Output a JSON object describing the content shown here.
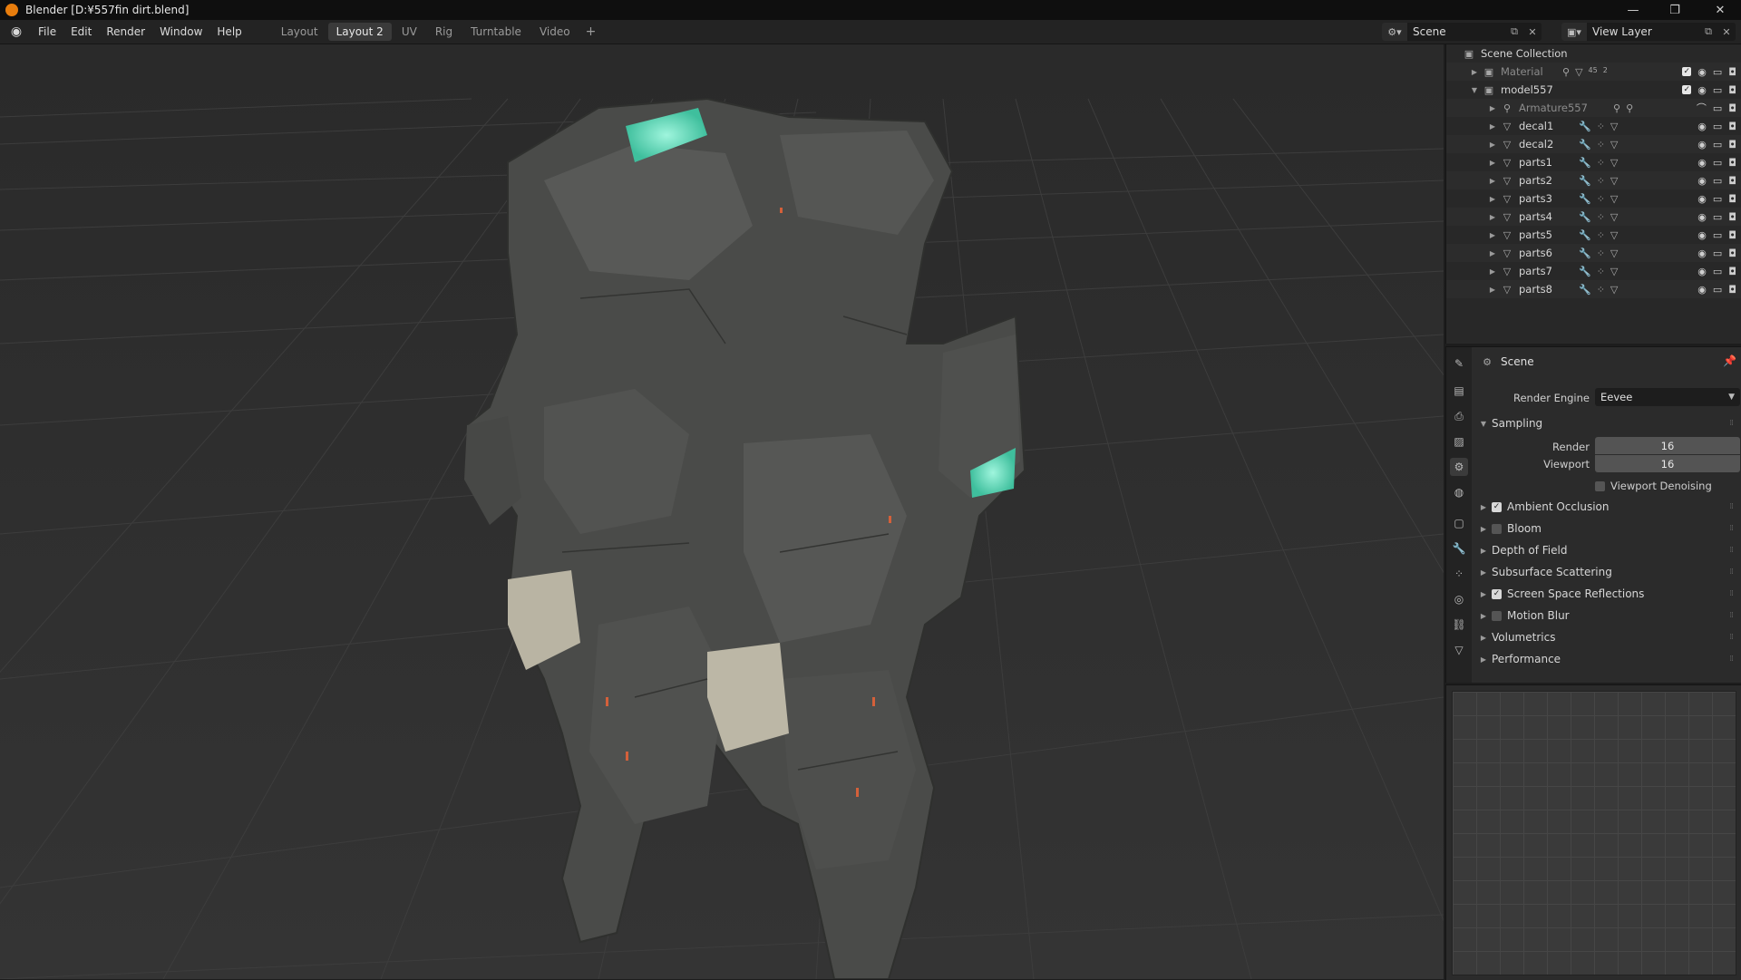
{
  "window": {
    "title": "Blender [D:¥557fin dirt.blend]",
    "controls": [
      "minimize",
      "restore",
      "close"
    ]
  },
  "menu": {
    "items": [
      "File",
      "Edit",
      "Render",
      "Window",
      "Help"
    ]
  },
  "workspaces": {
    "tabs": [
      "Layout",
      "Layout 2",
      "UV",
      "Rig",
      "Turntable",
      "Video"
    ],
    "active": "Layout 2",
    "add_label": "+"
  },
  "header_right": {
    "scene_name": "Scene",
    "view_layer": "View Layer"
  },
  "outliner": {
    "root": "Scene Collection",
    "collections": [
      {
        "name": "Material",
        "dimmed": true,
        "count_a": "45",
        "count_b": "2"
      },
      {
        "name": "model557",
        "dimmed": false
      }
    ],
    "objects": [
      {
        "name": "Armature557",
        "dimmed": true
      },
      {
        "name": "decal1"
      },
      {
        "name": "decal2"
      },
      {
        "name": "parts1"
      },
      {
        "name": "parts2"
      },
      {
        "name": "parts3"
      },
      {
        "name": "parts4"
      },
      {
        "name": "parts5"
      },
      {
        "name": "parts6"
      },
      {
        "name": "parts7"
      },
      {
        "name": "parts8"
      }
    ]
  },
  "properties": {
    "context": "Scene",
    "render_engine_label": "Render Engine",
    "render_engine_value": "Eevee",
    "sampling": {
      "label": "Sampling",
      "render_label": "Render",
      "render_value": "16",
      "viewport_label": "Viewport",
      "viewport_value": "16",
      "denoise_label": "Viewport Denoising",
      "denoise_checked": false
    },
    "panels": [
      {
        "label": "Ambient Occlusion",
        "has_checkbox": true,
        "checked": true
      },
      {
        "label": "Bloom",
        "has_checkbox": true,
        "checked": false
      },
      {
        "label": "Depth of Field",
        "has_checkbox": false
      },
      {
        "label": "Subsurface Scattering",
        "has_checkbox": false
      },
      {
        "label": "Screen Space Reflections",
        "has_checkbox": true,
        "checked": true
      },
      {
        "label": "Motion Blur",
        "has_checkbox": true,
        "checked": false
      },
      {
        "label": "Volumetrics",
        "has_checkbox": false
      },
      {
        "label": "Performance",
        "has_checkbox": false
      }
    ]
  },
  "colors": {
    "accent_orange": "#e87d0d",
    "glow_teal": "#5fe3c0",
    "viewport_bg": "#2f2f2f",
    "panel_bg": "#2b2b2b"
  }
}
